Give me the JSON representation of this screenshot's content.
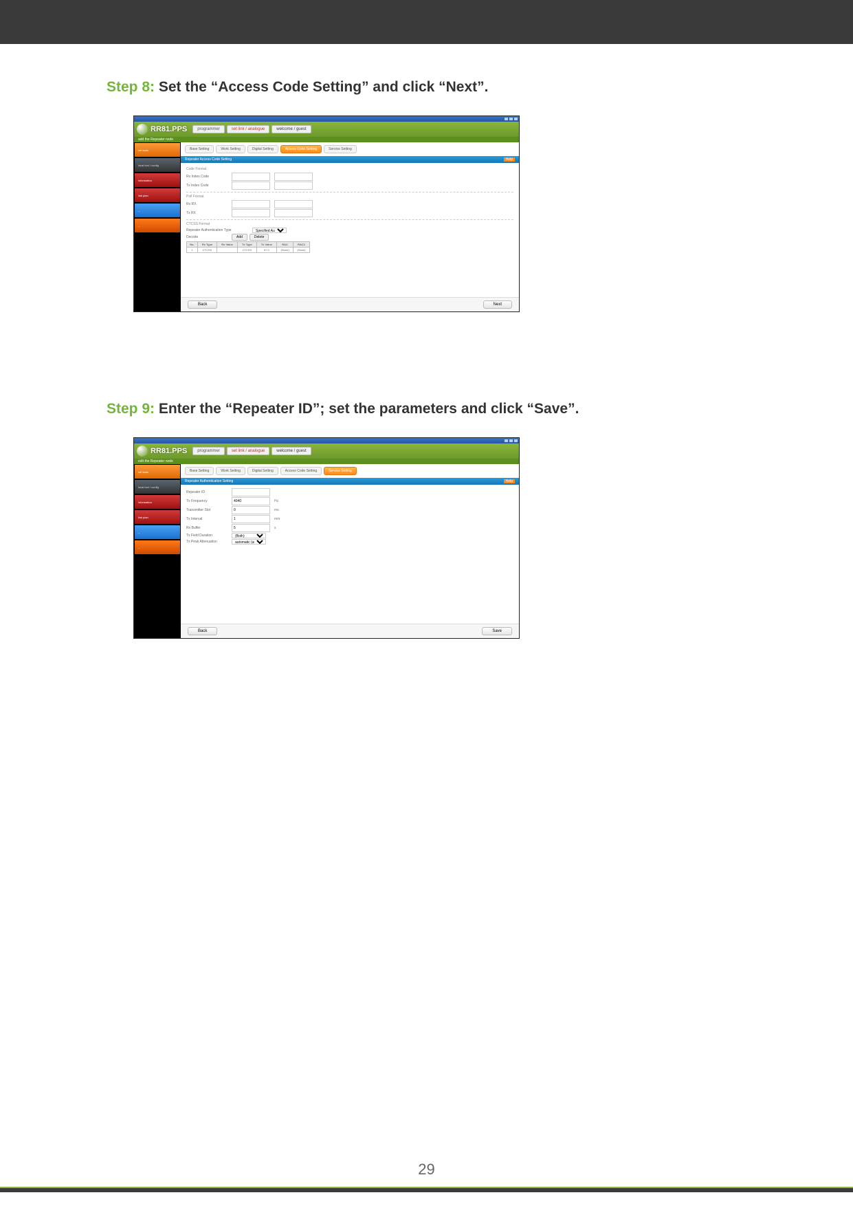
{
  "page_number": "29",
  "steps": {
    "s8": {
      "label": "Step 8:",
      "text": " Set the “Access Code Setting” and click “Next”."
    },
    "s9": {
      "label": "Step 9:",
      "text": " Enter the “Repeater ID”; set the parameters and click “Save”."
    }
  },
  "app": {
    "logo": "RR81.PPS",
    "header_btn1": "programmer",
    "header_btn1_sub": "set link / analogue",
    "header_btn2_sub": "welcome / guest",
    "breadcrumb_s8": "add the Repeater node",
    "breadcrumb_s9": "edit the Repeater node",
    "sidebar": [
      "set tools",
      "local tool / config",
      "information",
      "link plan",
      "--",
      "--"
    ],
    "footer_back": "Back",
    "footer_next": "Next",
    "footer_save": "Save"
  },
  "s8": {
    "tabs": [
      "Base Setting",
      "Work Setting",
      "Digital Setting",
      "Access Code Setting",
      "Service Setting"
    ],
    "section_title": "Repeater Access Code Setting",
    "section_help": "Help",
    "grp1": "Code Format",
    "r1": "Rx Index Code",
    "r2": "Tx Index Code",
    "grp2": "Poll Format",
    "r3": "Rx RX",
    "r4": "Tx RX",
    "grp3": "CTCSS Format",
    "r5": "Repeater Authentication Type",
    "r5v": "Specified Authentication",
    "r6": "Decode",
    "btn_add": "Add",
    "btn_del": "Delete",
    "tbl_headers": [
      "No.",
      "Rx Type",
      "Rx Value",
      "Tx Type",
      "Tx Value",
      "RAC",
      "RAC1"
    ],
    "tbl_row": [
      "1",
      "CTCSS",
      "",
      "CTCSS",
      "67.0",
      "(None)",
      "(None)"
    ]
  },
  "s9": {
    "tabs": [
      "Base Setting",
      "Work Setting",
      "Digital Setting",
      "Access Code Setting",
      "Service Setting"
    ],
    "section_title": "Repeater Authentication Setting",
    "rows": [
      {
        "label": "Repeater ID",
        "value": "",
        "unit": ""
      },
      {
        "label": "Tx Frequency",
        "value": "4040",
        "unit": "Hz"
      },
      {
        "label": "Transmitter Slot",
        "value": "0",
        "unit": "ms"
      },
      {
        "label": "Tx Interval",
        "value": "1",
        "unit": "mm"
      },
      {
        "label": "Rx Buffer",
        "value": "5",
        "unit": "s"
      },
      {
        "label": "Tx Field Duration",
        "value": "(Both)",
        "unit": ""
      },
      {
        "label": "Tx Peak Attenuation",
        "value": "automatic (auto)",
        "unit": ""
      }
    ]
  }
}
